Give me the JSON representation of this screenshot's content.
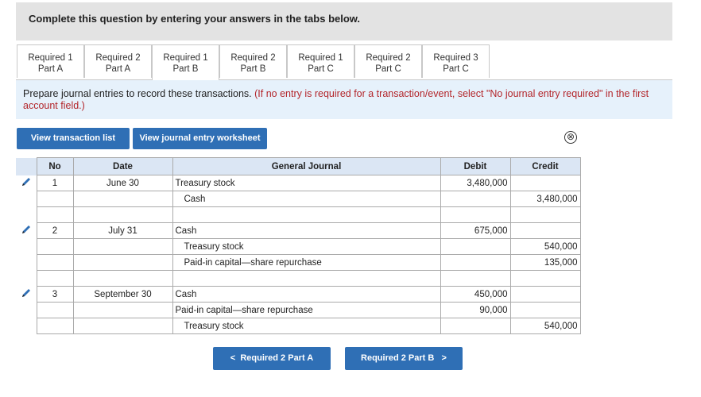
{
  "header": {
    "instruction": "Complete this question by entering your answers in the tabs below."
  },
  "tabs": [
    {
      "line1": "Required 1",
      "line2": "Part A",
      "active": false
    },
    {
      "line1": "Required 2",
      "line2": "Part A",
      "active": false
    },
    {
      "line1": "Required 1",
      "line2": "Part B",
      "active": true
    },
    {
      "line1": "Required 2",
      "line2": "Part B",
      "active": false
    },
    {
      "line1": "Required 1",
      "line2": "Part C",
      "active": false
    },
    {
      "line1": "Required 2",
      "line2": "Part C",
      "active": false
    },
    {
      "line1": "Required 3",
      "line2": "Part C",
      "active": false
    }
  ],
  "prompt": {
    "text": "Prepare journal entries to record these transactions. ",
    "note": "(If no entry is required for a transaction/event, select \"No journal entry required\" in the first account field.)"
  },
  "buttons": {
    "view_transactions": "View transaction list",
    "view_worksheet": "View journal entry worksheet",
    "close_symbol": "⊗"
  },
  "journal": {
    "headers": {
      "no": "No",
      "date": "Date",
      "account": "General Journal",
      "debit": "Debit",
      "credit": "Credit"
    },
    "rows": [
      {
        "no": "1",
        "date": "June 30",
        "account": "Treasury stock",
        "debit": "3,480,000",
        "credit": "",
        "indent": false,
        "editable": true
      },
      {
        "no": "",
        "date": "",
        "account": "Cash",
        "debit": "",
        "credit": "3,480,000",
        "indent": true,
        "editable": false
      },
      {
        "no": "",
        "date": "",
        "account": "",
        "debit": "",
        "credit": "",
        "indent": false,
        "editable": false
      },
      {
        "no": "2",
        "date": "July 31",
        "account": "Cash",
        "debit": "675,000",
        "credit": "",
        "indent": false,
        "editable": true
      },
      {
        "no": "",
        "date": "",
        "account": "Treasury stock",
        "debit": "",
        "credit": "540,000",
        "indent": true,
        "editable": false
      },
      {
        "no": "",
        "date": "",
        "account": "Paid-in capital—share repurchase",
        "debit": "",
        "credit": "135,000",
        "indent": true,
        "editable": false
      },
      {
        "no": "",
        "date": "",
        "account": "",
        "debit": "",
        "credit": "",
        "indent": false,
        "editable": false
      },
      {
        "no": "3",
        "date": "September 30",
        "account": "Cash",
        "debit": "450,000",
        "credit": "",
        "indent": false,
        "editable": true
      },
      {
        "no": "",
        "date": "",
        "account": "Paid-in capital—share repurchase",
        "debit": "90,000",
        "credit": "",
        "indent": false,
        "editable": false
      },
      {
        "no": "",
        "date": "",
        "account": "Treasury stock",
        "debit": "",
        "credit": "540,000",
        "indent": true,
        "editable": false
      }
    ]
  },
  "navigation": {
    "prev_label": "Required 2 Part A",
    "next_label": "Required 2 Part B",
    "prev_arrow": "<",
    "next_arrow": ">"
  },
  "colors": {
    "accent": "#2f6fb5",
    "note_red": "#b3262b",
    "tab_bar_bg": "#e3e3e3",
    "prompt_bg": "#e6f1fb",
    "header_bg": "#dbe6f4"
  }
}
